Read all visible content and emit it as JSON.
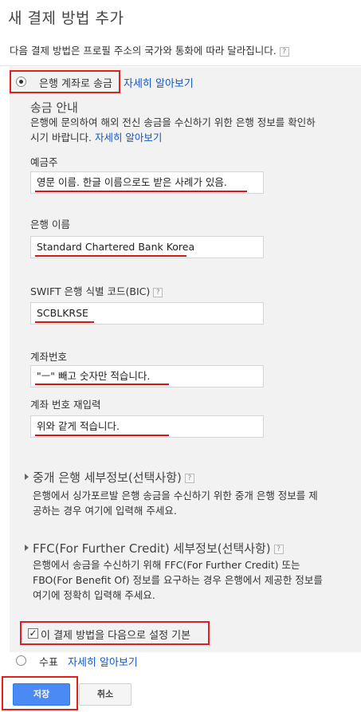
{
  "page": {
    "title": "새 결제 방법 추가",
    "description": "다음 결제 방법은 프로필 주소의 국가와 통화에 따라 달라집니다.",
    "help_glyph": "?"
  },
  "options": {
    "wire": {
      "label": "은행 계좌로 송금",
      "link": "자세히 알아보기",
      "selected": true
    },
    "check": {
      "label": "수표",
      "link": "자세히 알아보기",
      "selected": false
    }
  },
  "wire_info": {
    "heading": "송금 안내",
    "text_line1": "은행에 문의하여 해외 전신 송금을 수신하기 위한 은행 정보를 확인하",
    "text_line2": "시기 바랍니다.",
    "link": "자세히 알아보기"
  },
  "fields": {
    "account_holder": {
      "label": "예금주",
      "value": "영문 이름. 한글 이름으로도  받은 사례가 있음."
    },
    "bank_name": {
      "label": "은행 이름",
      "value": "Standard Chartered Bank Korea"
    },
    "swift": {
      "label": "SWIFT 은행 식별 코드(BIC)",
      "value": "SCBLKRSE"
    },
    "account_number": {
      "label": "계좌번호",
      "value": "\"ㅡ\" 빼고 숫자만 적습니다."
    },
    "account_number_confirm": {
      "label": "계좌 번호 재입력",
      "value": "위와 같게 적습니다."
    }
  },
  "intermediary": {
    "title": "중개 은행 세부정보(선택사항)",
    "line1": "은행에서 싱가포르발 은행 송금을 수신하기 위한 중개 은행 정보를 제",
    "line2": "공하는 경우 여기에 입력해 주세요."
  },
  "ffc": {
    "title": "FFC(For Further Credit) 세부정보(선택사항)",
    "line1": "은행에서 송금을 수신하기 위해 FFC(For Further Credit) 또는",
    "line2": "FBO(For Benefit Of) 정보를 요구하는 경우 은행에서 제공한 정보를",
    "line3": "여기에 정확히 입력해 주세요."
  },
  "default_checkbox": {
    "label": "이 결제 방법을 다음으로 설정 기본",
    "checked": true,
    "check_glyph": "✓"
  },
  "buttons": {
    "save": "저장",
    "cancel": "취소"
  },
  "colors": {
    "highlight": "#e0201c",
    "link": "#1155cc",
    "primary": "#4a8af4",
    "panel": "#f2f2f2"
  }
}
